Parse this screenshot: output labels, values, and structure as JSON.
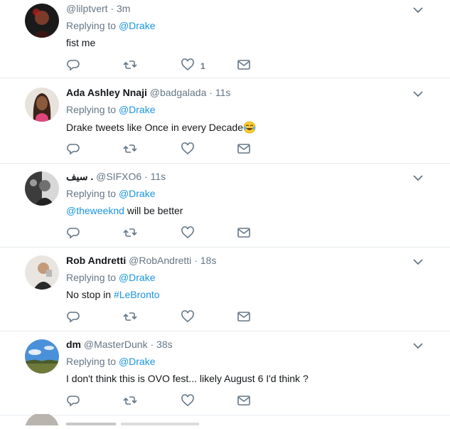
{
  "replying_prefix": "Replying to",
  "tweets": [
    {
      "name": "",
      "handle": "@lilptvert",
      "time": "3m",
      "reply_to": "@Drake",
      "text": "fist me",
      "like_count": "1"
    },
    {
      "name": "Ada Ashley Nnaji",
      "handle": "@badgalada",
      "time": "11s",
      "reply_to": "@Drake",
      "text": "Drake tweets like Once in every Decade",
      "emoji": "tears-of-joy"
    },
    {
      "name": "سيف .",
      "handle": "@SIFXO6",
      "time": "11s",
      "reply_to": "@Drake",
      "text_link": "@theweeknd",
      "text": " will be better"
    },
    {
      "name": "Rob Andretti",
      "handle": "@RobAndretti",
      "time": "18s",
      "reply_to": "@Drake",
      "text": "No stop in ",
      "text_link": "#LeBronto"
    },
    {
      "name": "dm",
      "handle": "@MasterDunk",
      "time": "38s",
      "reply_to": "@Drake",
      "text": "I don't think this is OVO fest... likely August 6 I'd think ?"
    }
  ],
  "colors": {
    "link": "#1b95e0",
    "secondary": "#657786",
    "divider": "#e6ecf0"
  },
  "icons": [
    "reply-icon",
    "retweet-icon",
    "like-icon",
    "direct-message-icon",
    "chevron-down-icon"
  ]
}
